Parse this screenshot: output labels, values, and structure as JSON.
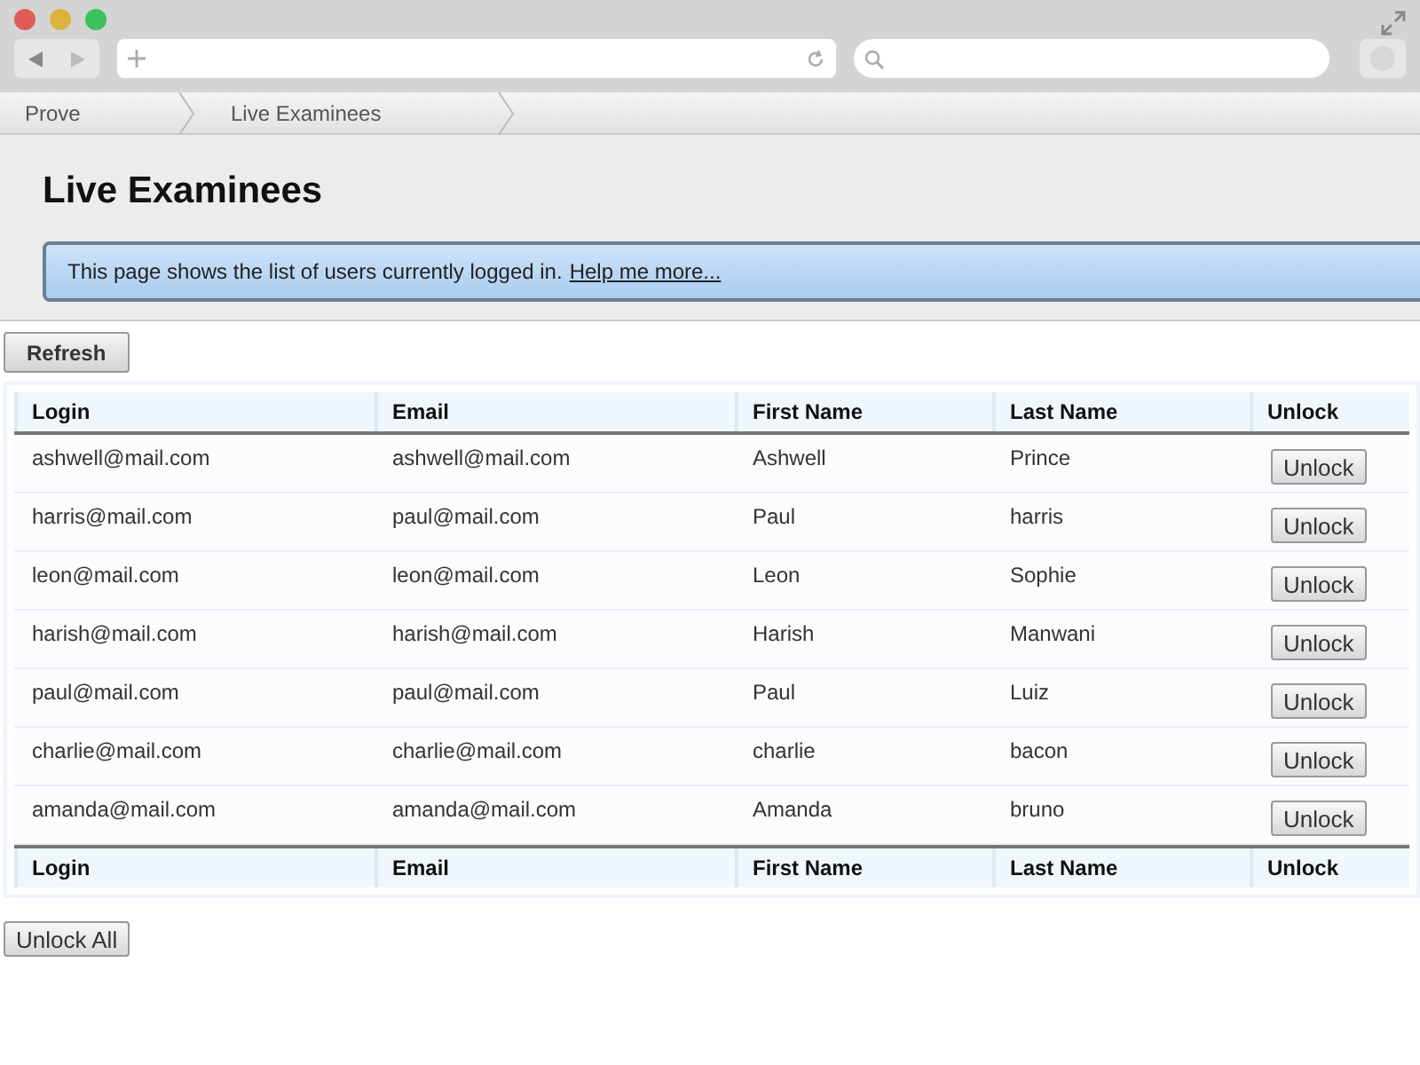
{
  "breadcrumbs": [
    "Prove",
    "Live Examinees"
  ],
  "page": {
    "title": "Live Examinees",
    "info": "This page shows the list of users currently logged in.",
    "help_link": "Help me more..."
  },
  "refresh_button": "Refresh",
  "table": {
    "columns": [
      "Login",
      "Email",
      "First Name",
      "Last Name",
      "Unlock"
    ],
    "rows": [
      {
        "cells": [
          "ashwell@mail.com",
          "ashwell@mail.com",
          "Ashwell",
          "Prince"
        ],
        "button": "Unlock"
      },
      {
        "cells": [
          "harris@mail.com",
          "paul@mail.com",
          "Paul",
          "harris"
        ],
        "button": "Unlock"
      },
      {
        "cells": [
          "leon@mail.com",
          "leon@mail.com",
          "Leon",
          "Sophie"
        ],
        "button": "Unlock"
      },
      {
        "cells": [
          "harish@mail.com",
          "harish@mail.com",
          "Harish",
          "Manwani"
        ],
        "button": "Unlock"
      },
      {
        "cells": [
          "paul@mail.com",
          "paul@mail.com",
          "Paul",
          "Luiz"
        ],
        "button": "Unlock"
      },
      {
        "cells": [
          "charlie@mail.com",
          "charlie@mail.com",
          "charlie",
          "bacon"
        ],
        "button": "Unlock"
      },
      {
        "cells": [
          "amanda@mail.com",
          "amanda@mail.com",
          "Amanda",
          "bruno"
        ],
        "button": "Unlock"
      }
    ],
    "footer_columns": [
      "Login",
      "Email",
      "First Name",
      "Last Name",
      "Unlock"
    ]
  },
  "unlock_all_button": "Unlock All"
}
